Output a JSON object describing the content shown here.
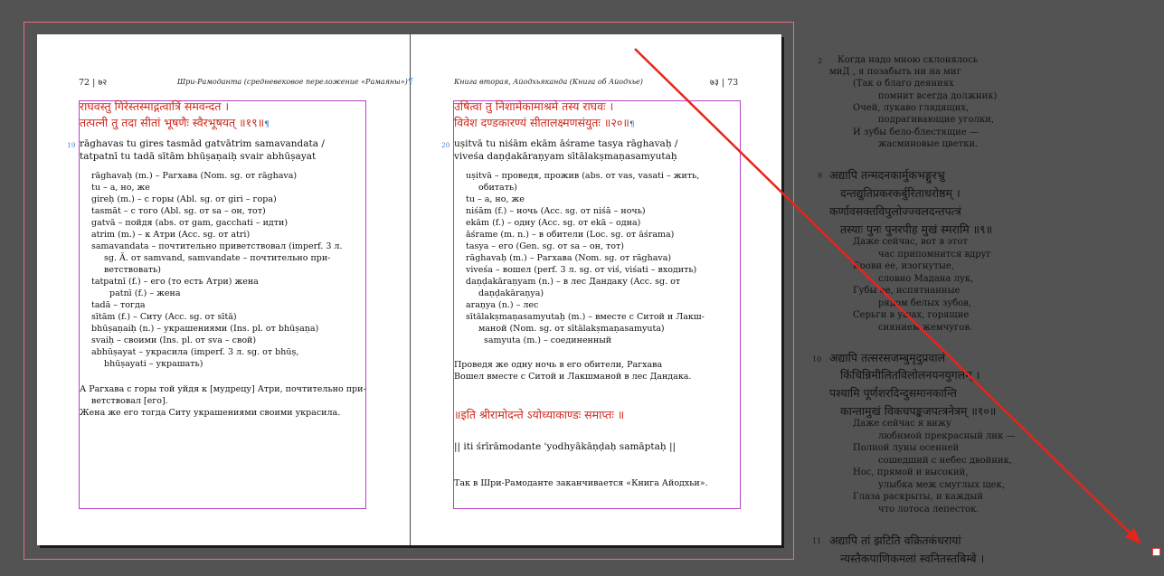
{
  "left_page": {
    "folio": "72",
    "folio_deva": "७२",
    "running_head": "Шри-Рамоданта (средневековое переложение «Рамаяны»)",
    "verse_number": "19",
    "deva_line1": "राघवस्तु गिरेस्तस्माद्गत्वात्रिं समवन्दत ।",
    "deva_line2": "तत्पत्नी तु तदा सीतां भूषणैः स्वैरभूषयत् ॥१९॥",
    "iast_line1": "rāghavas tu gires tasmād gatvātrim samavandata /",
    "iast_line2": "tatpatnī tu tadā sītām bhūṣaṇaiḥ svair abhūṣayat",
    "gloss": [
      "rāghavaḥ (m.) – Рагхава (Nom. sg. от rāghava)",
      "tu – а, но, же",
      "gireḥ (m.) – с горы (Abl. sg. от giri – гора)",
      "tasmāt – с того (Abl. sg. от sa – он, тот)",
      "gatvā – пойдя (abs. от gam, gacchati – идти)",
      "atrim (m.) – к Атри (Acc. sg. от atri)",
      "samavandata – почтительно приветствовал (imperf. 3 л.",
      "sg. Ā. от samvand, samvandate – почтительно при-",
      "ветствовать)",
      "tatpatnī (f.) – его (то есть Атри) жена",
      "patnī (f.) – жена",
      "tadā – тогда",
      "sītām (f.) – Ситу (Acc. sg. от sītā)",
      "bhūṣaṇaiḥ (n.) – украшениями (Ins. pl. от bhūṣaṇa)",
      "svaiḥ – своими (Ins. pl. от sva – свой)",
      "abhūṣayat – украсила (imperf. 3 л. sg. от bhūṣ,",
      "bhūṣayati – украшать)"
    ],
    "translation": [
      "А Рагхава с горы той уйдя к [мудрецу] Атри, почтительно при-",
      "ветствовал [его].",
      "Жена же его тогда Ситу украшениями своими украсила."
    ]
  },
  "right_page": {
    "folio": "73",
    "folio_deva": "७३",
    "running_head": "Книга вторая, Айодхьяканда (Книга об Айодхье)",
    "verse_number": "20",
    "deva_line1": "उषित्वा तु निशामेकामाश्रमे तस्य राघवः ।",
    "deva_line2": "विवेश दण्डकारण्यं सीतालक्ष्मणसंयुतः ॥२०॥",
    "iast_line1": "uṣitvā tu niśām ekām āśrame tasya rāghavaḥ /",
    "iast_line2": "viveśa daṇḍakāraṇyam sītālakṣmaṇasamyutaḥ",
    "gloss": [
      "uṣitvā – проведя, прожив (abs. от vas, vasati – жить,",
      "обитать)",
      "tu – а, но, же",
      "niśām (f.) – ночь (Acc. sg. от niśā – ночь)",
      "ekām (f.) – одну (Acc. sg. от ekā – одна)",
      "āśrame (m. n.) – в обители (Loc. sg. от āśrama)",
      "tasya – его (Gen. sg. от sa – он, тот)",
      "rāghavaḥ (m.) – Рагхава (Nom. sg. от rāghava)",
      "viveśa – вошел (perf. 3 л. sg. от viś, viśati – входить)",
      "daṇḍakāraṇyam (n.) – в лес Дандаку (Acc. sg. от",
      "daṇḍakāraṇya)",
      "araṇya (n.) – лес",
      "sītālakṣmaṇasamyutaḥ (m.) – вместе с Ситой и Лакш-",
      "маной (Nom. sg. от sītālakṣmaṇasamyuta)",
      "samyuta (m.) – соединенный"
    ],
    "translation": [
      "Проведя же одну ночь в его обители, Рагхава",
      "Вошел вместе с Ситой и Лакшманой в лес Дандака."
    ],
    "colophon_deva": "॥इति श्रीरामोदन्ते ऽयोध्याकाण्डः समाप्तः ॥",
    "colophon_iast": "|| iti śrīrāmodante 'yodhyākāṇḍaḥ samāptaḥ ||",
    "closing": "Так в Шри-Рамоданте заканчивается «Книга Айодхьи»."
  },
  "pasteboard": {
    "block1": {
      "number": "2",
      "lines": [
        "Когда надо мною склонялось",
        "миД , я позабыть ни на миг",
        "(Так о благо деяниях",
        "помнит всегда должник)",
        "Очей, лукаво глядящих,",
        "подрагивающие уголки,",
        "И зубы бело-блестящие —",
        "жасминовые цветки."
      ]
    },
    "block2": {
      "number": "9",
      "deva": [
        "अद्यापि तन्मदनकार्मुकभङ्गुरभ्रु",
        "दन्तद्युतिप्रकरकर्बुरिताधरोष्ठम् ।",
        "कर्णावसक्तविपुलोज्ज्वलदन्तपत्त्रं",
        "तस्याः पुनः पुनरपीह मुखं स्मरामि ॥९॥"
      ],
      "lines": [
        "Даже сейчас, вот в этот",
        "час припомнится вдруг",
        "Брови ее, изогнутые,",
        "словно Мадана лук,",
        "Губы ее, испятнанные",
        "рядом белых зубов,",
        "Серьги в ушах, горящие",
        "сиянием жемчугов."
      ]
    },
    "block3": {
      "number": "10",
      "deva": [
        "अद्यापि तत्सरसजम्बुमृदुप्रवालं",
        "किंचिन्निमीलितविलोलनयनयुगलम् ।",
        "पश्यामि पूर्णशरदिन्दुसमानकान्ति",
        "कान्तामुखं विकचपङ्कजपत्त्रनेत्रम् ॥१०॥"
      ],
      "lines": [
        "Даже сейчас я вижу",
        "любимой прекрасный лик —",
        "Полной луны осенней",
        "сошедший с небес двойник,",
        "Нос, прямой и высокий,",
        "улыбка меж смуглых щек,",
        "Глаза раскрыты, и каждый",
        "что лотоса лепесток."
      ]
    },
    "block4": {
      "number": "11",
      "deva": [
        "अद्यापि तां झटिति वक्रितकंधरायां",
        "न्यस्तैकपाणिकमलां स्वनितस्तबिम्बे ।"
      ]
    }
  },
  "colors": {
    "workspace": "#535353",
    "sanskrit_red": "#d0281c",
    "margin_guides": "#b540c4",
    "bleed_frame": "#e0707c",
    "hidden_chars": "#3a7bd5",
    "arrow": "#e8231b"
  }
}
